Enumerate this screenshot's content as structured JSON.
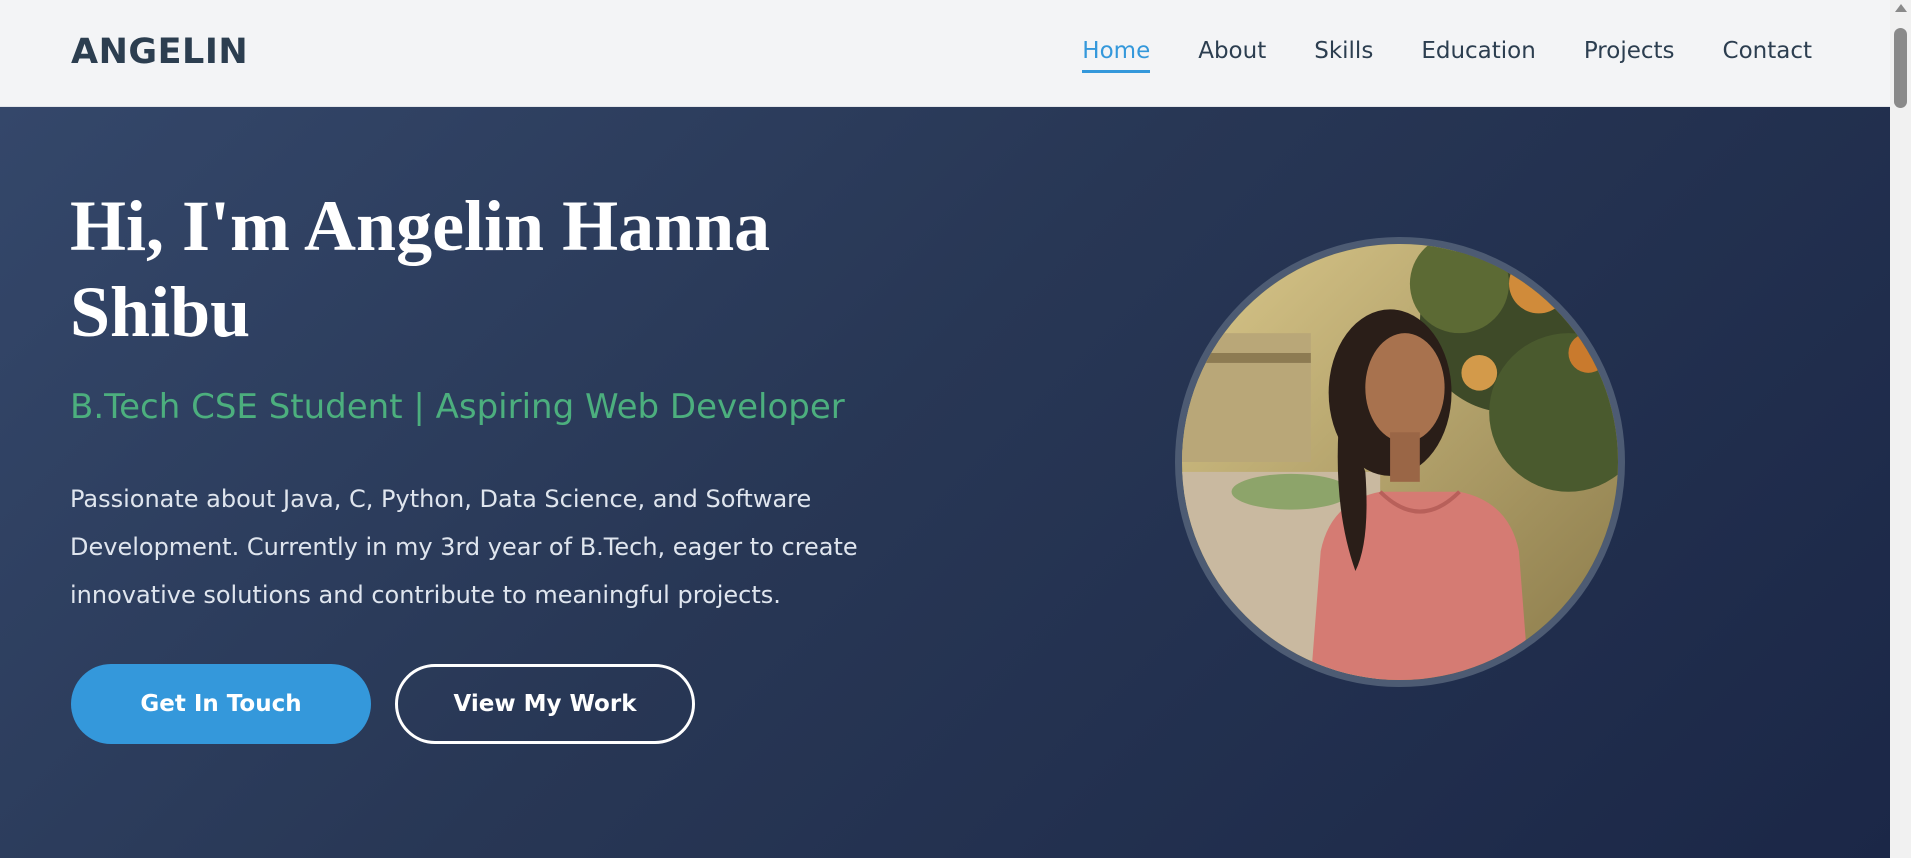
{
  "nav": {
    "logo": "ANGELIN",
    "links": [
      "Home",
      "About",
      "Skills",
      "Education",
      "Projects",
      "Contact"
    ],
    "active": "Home"
  },
  "hero": {
    "title": "Hi, I'm Angelin Hanna Shibu",
    "subtitle": "B.Tech CSE Student | Aspiring Web Developer",
    "description": "Passionate about Java, C, Python, Data Science, and Software Development. Currently in my 3rd year of B.Tech, eager to create innovative solutions and contribute to meaningful projects.",
    "primary_button": "Get In Touch",
    "secondary_button": "View My Work"
  },
  "colors": {
    "accent": "#3498db",
    "subtitle_green": "#4caf7e",
    "hero_bg_start": "#34476a",
    "hero_bg_end": "#1b2747",
    "nav_text": "#2c3e50"
  }
}
